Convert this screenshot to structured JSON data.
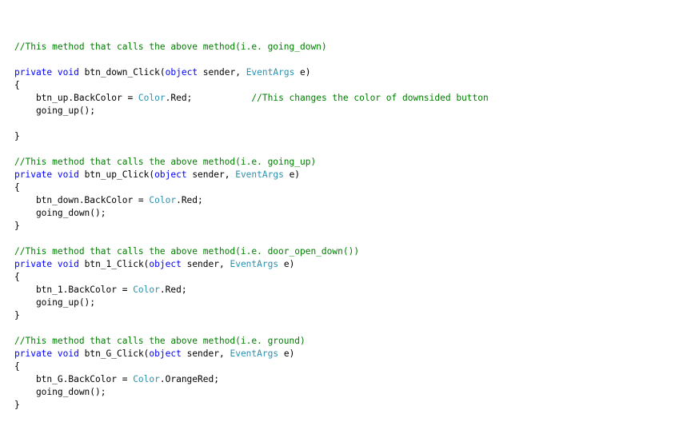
{
  "colors": {
    "comment": "#008000",
    "keyword": "#0000ff",
    "type": "#2b91af",
    "plain": "#000000",
    "background": "#ffffff"
  },
  "code": {
    "lines": [
      [],
      [
        {
          "t": "//This method that calls the above method(i.e. going_down)",
          "k": "cm"
        }
      ],
      [],
      [
        {
          "t": "private",
          "k": "kw"
        },
        {
          "t": " ",
          "k": "pl"
        },
        {
          "t": "void",
          "k": "kw"
        },
        {
          "t": " btn_down_Click(",
          "k": "pl"
        },
        {
          "t": "object",
          "k": "kw"
        },
        {
          "t": " sender, ",
          "k": "pl"
        },
        {
          "t": "EventArgs",
          "k": "ty"
        },
        {
          "t": " e)",
          "k": "pl"
        }
      ],
      [
        {
          "t": "{",
          "k": "pl"
        }
      ],
      [
        {
          "t": "    btn_up.BackColor = ",
          "k": "pl"
        },
        {
          "t": "Color",
          "k": "ty"
        },
        {
          "t": ".Red;           ",
          "k": "pl"
        },
        {
          "t": "//This changes the color of downsided button",
          "k": "cm"
        }
      ],
      [
        {
          "t": "    going_up();",
          "k": "pl"
        }
      ],
      [],
      [
        {
          "t": "}",
          "k": "pl"
        }
      ],
      [],
      [
        {
          "t": "//This method that calls the above method(i.e. going_up)",
          "k": "cm"
        }
      ],
      [
        {
          "t": "private",
          "k": "kw"
        },
        {
          "t": " ",
          "k": "pl"
        },
        {
          "t": "void",
          "k": "kw"
        },
        {
          "t": " btn_up_Click(",
          "k": "pl"
        },
        {
          "t": "object",
          "k": "kw"
        },
        {
          "t": " sender, ",
          "k": "pl"
        },
        {
          "t": "EventArgs",
          "k": "ty"
        },
        {
          "t": " e)",
          "k": "pl"
        }
      ],
      [
        {
          "t": "{",
          "k": "pl"
        }
      ],
      [
        {
          "t": "    btn_down.BackColor = ",
          "k": "pl"
        },
        {
          "t": "Color",
          "k": "ty"
        },
        {
          "t": ".Red;",
          "k": "pl"
        }
      ],
      [
        {
          "t": "    going_down();",
          "k": "pl"
        }
      ],
      [
        {
          "t": "}",
          "k": "pl"
        }
      ],
      [],
      [
        {
          "t": "//This method that calls the above method(i.e. door_open_down())",
          "k": "cm"
        }
      ],
      [
        {
          "t": "private",
          "k": "kw"
        },
        {
          "t": " ",
          "k": "pl"
        },
        {
          "t": "void",
          "k": "kw"
        },
        {
          "t": " btn_1_Click(",
          "k": "pl"
        },
        {
          "t": "object",
          "k": "kw"
        },
        {
          "t": " sender, ",
          "k": "pl"
        },
        {
          "t": "EventArgs",
          "k": "ty"
        },
        {
          "t": " e)",
          "k": "pl"
        }
      ],
      [
        {
          "t": "{",
          "k": "pl"
        }
      ],
      [
        {
          "t": "    btn_1.BackColor = ",
          "k": "pl"
        },
        {
          "t": "Color",
          "k": "ty"
        },
        {
          "t": ".Red;",
          "k": "pl"
        }
      ],
      [
        {
          "t": "    going_up();",
          "k": "pl"
        }
      ],
      [
        {
          "t": "}",
          "k": "pl"
        }
      ],
      [],
      [
        {
          "t": "//This method that calls the above method(i.e. ground)",
          "k": "cm"
        }
      ],
      [
        {
          "t": "private",
          "k": "kw"
        },
        {
          "t": " ",
          "k": "pl"
        },
        {
          "t": "void",
          "k": "kw"
        },
        {
          "t": " btn_G_Click(",
          "k": "pl"
        },
        {
          "t": "object",
          "k": "kw"
        },
        {
          "t": " sender, ",
          "k": "pl"
        },
        {
          "t": "EventArgs",
          "k": "ty"
        },
        {
          "t": " e)",
          "k": "pl"
        }
      ],
      [
        {
          "t": "{",
          "k": "pl"
        }
      ],
      [
        {
          "t": "    btn_G.BackColor = ",
          "k": "pl"
        },
        {
          "t": "Color",
          "k": "ty"
        },
        {
          "t": ".OrangeRed;",
          "k": "pl"
        }
      ],
      [
        {
          "t": "    going_down();",
          "k": "pl"
        }
      ],
      [
        {
          "t": "}",
          "k": "pl"
        }
      ]
    ]
  }
}
